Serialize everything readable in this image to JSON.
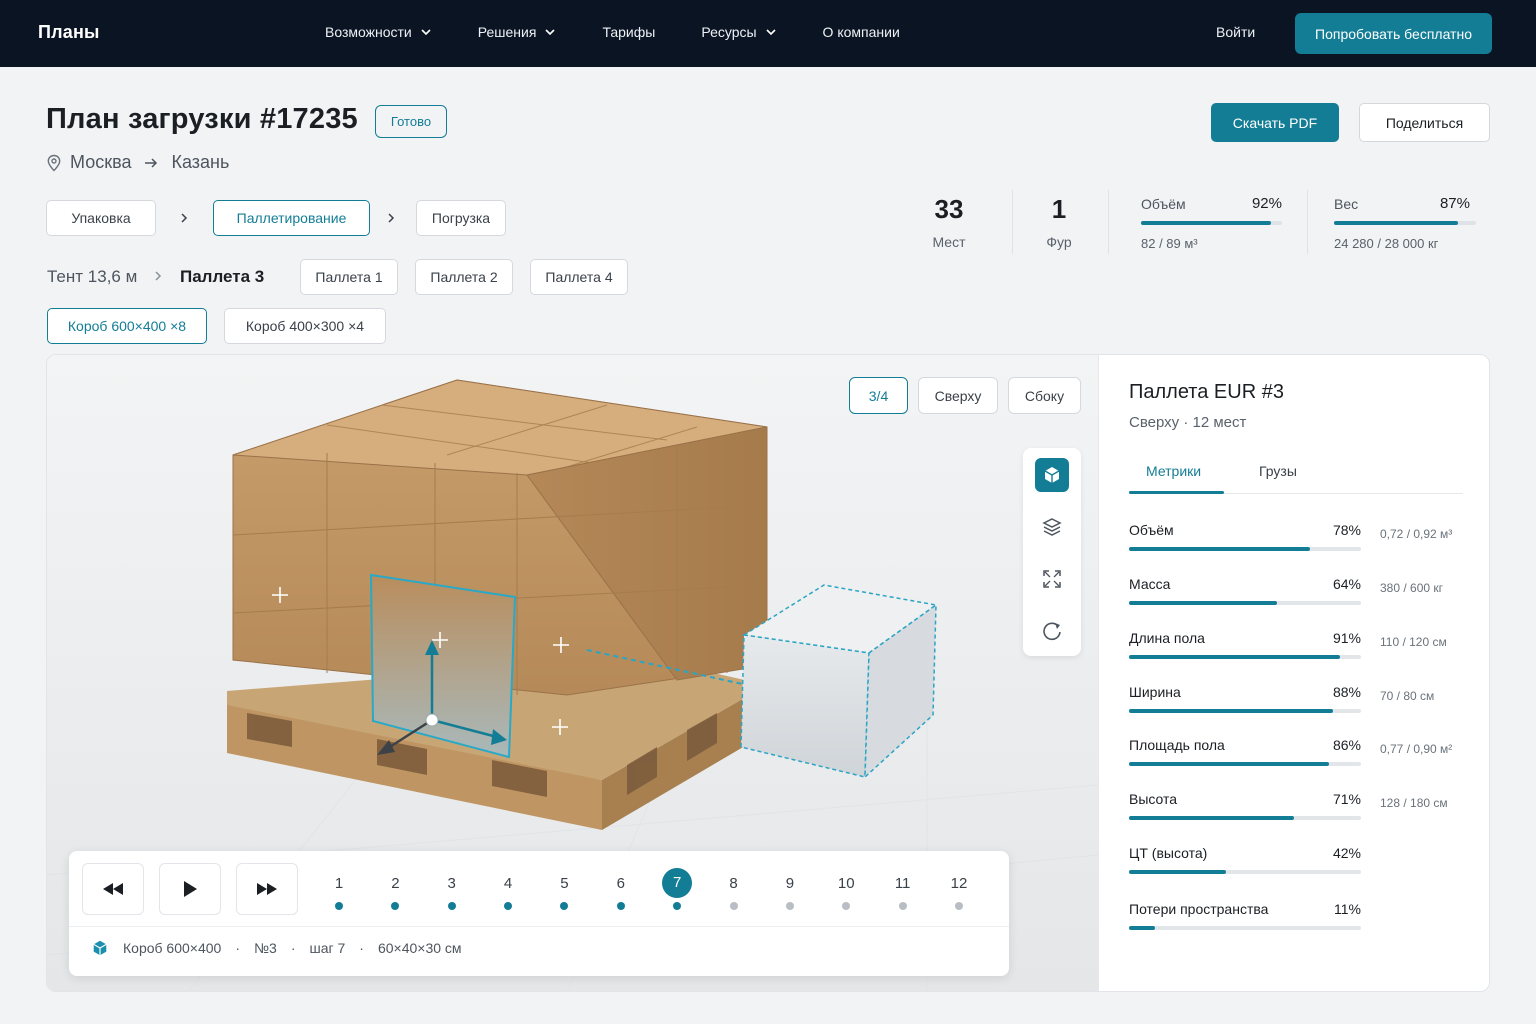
{
  "nav": {
    "brand": "Планы",
    "items": [
      {
        "label": "Возможности",
        "dropdown": true
      },
      {
        "label": "Решения",
        "dropdown": true
      },
      {
        "label": "Тарифы",
        "dropdown": false
      },
      {
        "label": "Ресурсы",
        "dropdown": true
      },
      {
        "label": "О компании",
        "dropdown": false
      }
    ],
    "login": "Войти",
    "cta": "Попробовать бесплатно"
  },
  "header": {
    "title": "План загрузки #17235",
    "status": "Готово",
    "route_from": "Москва",
    "route_to": "Казань",
    "download": "Скачать PDF",
    "share": "Поделиться"
  },
  "steps": [
    "Упаковка",
    "Паллетирование",
    "Погрузка"
  ],
  "active_step": 1,
  "breadcrumb": {
    "truck": "Тент 13,6 м",
    "current": "Паллета 3"
  },
  "pallets": [
    "Паллета 1",
    "Паллета 2",
    "Паллета 4"
  ],
  "boxes": [
    {
      "label": "Короб 600×400 ×8",
      "active": true
    },
    {
      "label": "Короб 400×300 ×4",
      "active": false
    }
  ],
  "stats": {
    "places": {
      "value": "33",
      "label": "Мест"
    },
    "trucks": {
      "value": "1",
      "label": "Фур"
    },
    "volume": {
      "label": "Объём",
      "pct": "92%",
      "fill": 0.92,
      "sub": "82 / 89 м³"
    },
    "weight": {
      "label": "Вес",
      "pct": "87%",
      "fill": 0.87,
      "sub": "24 280 / 28 000 кг"
    }
  },
  "view": {
    "counter": "3/4",
    "top": "Сверху",
    "side": "Сбоку"
  },
  "tools": [
    "cube-icon",
    "layers-icon",
    "fit-screen-icon",
    "rotate-icon"
  ],
  "player": {
    "steps": [
      "1",
      "2",
      "3",
      "4",
      "5",
      "6",
      "7",
      "8",
      "9",
      "10",
      "11",
      "12"
    ],
    "current": 7,
    "info": {
      "box": "Короб 600×400",
      "num": "№3",
      "step": "шаг 7",
      "dims": "60×40×30 см"
    }
  },
  "panel": {
    "title": "Паллета EUR #3",
    "subtitle": "Сверху",
    "places": "12 мест",
    "tabs": [
      "Метрики",
      "Грузы"
    ],
    "metrics": [
      {
        "label": "Объём",
        "pct": "78%",
        "fill": 0.78,
        "extra": "0,72 / 0,92 м³"
      },
      {
        "label": "Масса",
        "pct": "64%",
        "fill": 0.64,
        "extra": "380 / 600 кг"
      },
      {
        "label": "Длина пола",
        "pct": "91%",
        "fill": 0.91,
        "extra": "110 / 120 см"
      },
      {
        "label": "Ширина",
        "pct": "88%",
        "fill": 0.88,
        "extra": "70 / 80 см"
      },
      {
        "label": "Площадь пола",
        "pct": "86%",
        "fill": 0.86,
        "extra": "0,77 / 0,90 м²"
      },
      {
        "label": "Высота",
        "pct": "71%",
        "fill": 0.71,
        "extra": "128 / 180 см"
      },
      {
        "label": "ЦТ (высота)",
        "pct": "42%",
        "fill": 0.42,
        "extra": ""
      },
      {
        "label": "Потери пространства",
        "pct": "11%",
        "fill": 0.11,
        "extra": ""
      }
    ]
  },
  "colors": {
    "accent": "#137d96",
    "nav_bg": "#0b1422",
    "box": "#c49a68"
  }
}
